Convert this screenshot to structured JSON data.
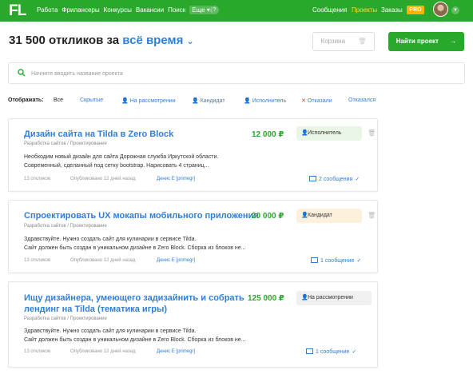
{
  "topbar": {
    "logo": "FL",
    "nav": [
      "Работа",
      "Фрилансеры",
      "Конкурсы",
      "Вакансии",
      "Поиск"
    ],
    "more": "Еще",
    "help": "?",
    "right_nav": [
      "Сообщения",
      "Проекты",
      "Заказы"
    ],
    "pro": "PRO",
    "accent": "#2aa82b",
    "active_color": "#ffe11a"
  },
  "header": {
    "count_text": "31 500 откликов за",
    "period": "всё время",
    "cart_label": "Корзина",
    "find_label": "Найти проект"
  },
  "search": {
    "placeholder": "Начните вводить название проекта"
  },
  "filters": {
    "label": "Отображать:",
    "items": [
      {
        "label": "Все",
        "icon": ""
      },
      {
        "label": "Скрытые",
        "icon": ""
      },
      {
        "label": "На рассмотрении",
        "icon": "user-grey-icon"
      },
      {
        "label": "Кандидат",
        "icon": "user-orange-icon"
      },
      {
        "label": "Исполнитель",
        "icon": "user-green-icon"
      },
      {
        "label": "Отказали",
        "icon": "cross-red-icon"
      },
      {
        "label": "Отказался",
        "icon": ""
      }
    ]
  },
  "cards": [
    {
      "title": "Дизайн сайта на Tilda в Zero Block",
      "price": "12 000 ₽",
      "status": "Исполнитель",
      "status_color": "#e9f6e6",
      "category": "Разработка сайтов / Проектирование",
      "desc_1": "Необходим новый дизайн для сайта Дорожная служба Иркутской области.",
      "desc_2": "Современный, сделанный под сетку bootstrap. Нарисовать 4 страниц...",
      "responses": "13 откликов",
      "published": "Опубликовано 12 дней назад",
      "author": "Денис Е [primegr]",
      "messages": "2 сообщения"
    },
    {
      "title": "Спроектировать UX мокапы мобильного приложения",
      "price": "20 000 ₽",
      "status": "Кандидат",
      "status_color": "#fdf1dd",
      "category": "Разработка сайтов / Проектирование",
      "desc_1": "Здравствуйте. Нужно создать сайт для кулинарии в сервисе Tilda.",
      "desc_2": "Сайт должен быть создан в уникальном дизайне в Zero Block. Сборка из блоков не...",
      "responses": "13 откликов",
      "published": "Опубликовано 12 дней назад",
      "author": "Денис Е [primegr]",
      "messages": "1 сообщение"
    },
    {
      "title_1": "Ищу дизайнера, умеющего задизайнить и собрать",
      "title_2": "лендинг на Tilda (тематика игры)",
      "price": "125 000 ₽",
      "status": "На рассмотрении",
      "status_color": "#f0f0f0",
      "category": "Разработка сайтов / Проектирование",
      "desc_1": "Здравствуйте. Нужно создать сайт для кулинарии в сервисе Tilda.",
      "desc_2": "Сайт должен быть создан в уникальном дизайне в Zero Block. Сборка из блоков не...",
      "responses": "13 откликов",
      "published": "Опубликовано 12 дней назад",
      "author": "Денис Е [primegr]",
      "messages": "1 сообщение"
    }
  ]
}
